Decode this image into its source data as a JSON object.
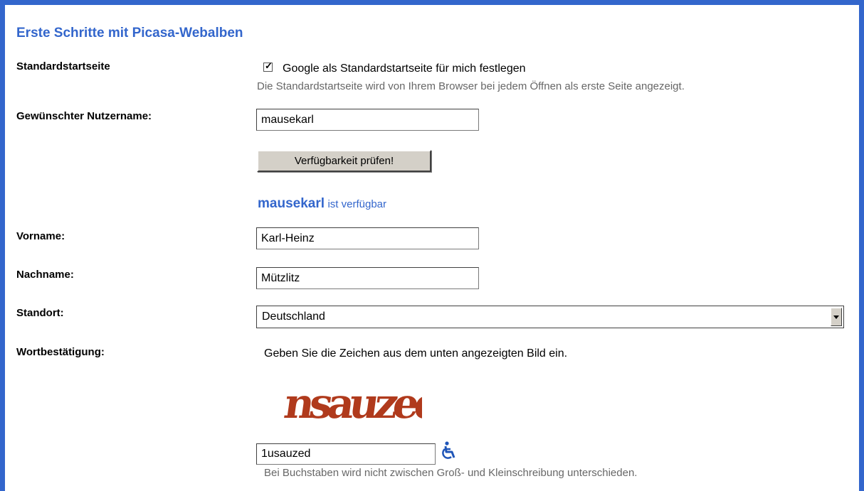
{
  "title": "Erste Schritte mit Picasa-Webalben",
  "homepage": {
    "label": "Standardstartseite",
    "checkbox_label": "Google als Standardstartseite für mich festlegen",
    "checked": true,
    "hint": "Die Standardstartseite wird von Ihrem Browser bei jedem Öffnen als erste Seite angezeigt."
  },
  "username": {
    "label": "Gewünschter Nutzername:",
    "value": "mausekarl",
    "check_button": "Verfügbarkeit prüfen!",
    "availability_name": "mausekarl",
    "availability_text": "ist verfügbar"
  },
  "firstname": {
    "label": "Vorname:",
    "value": "Karl-Heinz"
  },
  "lastname": {
    "label": "Nachname:",
    "value": "Mützlitz"
  },
  "location": {
    "label": "Standort:",
    "value": "Deutschland"
  },
  "captcha": {
    "label": "Wortbestätigung:",
    "instruction": "Geben Sie die Zeichen aus dem unten angezeigten Bild ein.",
    "image_text": "nsauzed",
    "value": "1usauzed",
    "hint": "Bei Buchstaben wird nicht zwischen Groß- und Kleinschreibung unterschieden.",
    "accessibility_icon": "wheelchair-icon"
  },
  "colors": {
    "frame": "#3366cc",
    "title": "#3366cc",
    "captcha_text": "#b03a1c",
    "hint": "#676767"
  }
}
